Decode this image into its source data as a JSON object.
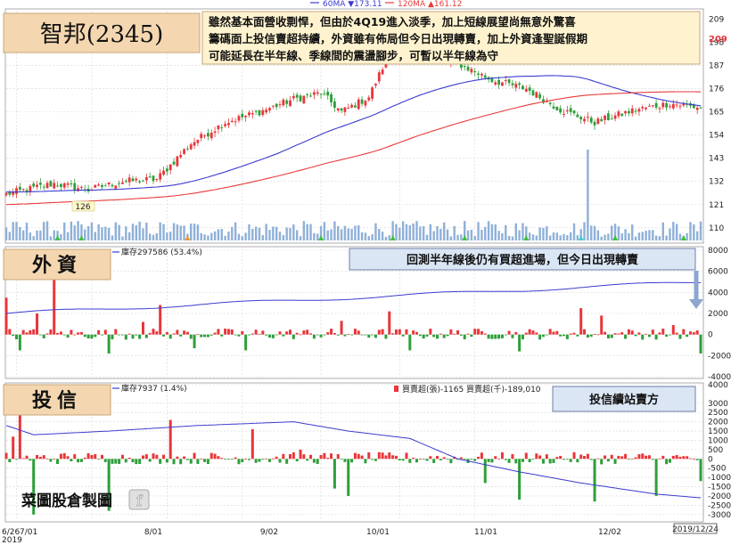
{
  "title": {
    "stock": "智邦(2345)"
  },
  "legend": {
    "ma60": "60MA ▼173.11",
    "ma120": "120MA ▲161.12",
    "ma60_color": "#3b3bd0",
    "ma120_color": "#e83a3a"
  },
  "note": {
    "lines": [
      "雖然基本面營收剽悍，但由於4Q19進入淡季，加上短線展望尚無意外驚喜",
      "籌碼面上投信賣超持續，外資雖有佈局但今日出現轉賣，加上外資逢聖誕假期",
      "可能延長在半年線、季線間的震盪腳步，可暫以半年線為守"
    ]
  },
  "panels": {
    "foreign": {
      "label": "外資",
      "inventory_label": "庫存297586 (53.4%)",
      "annotation": "回測半年線後仍有買超進場，但今日出現轉賣"
    },
    "trust": {
      "label": "投信",
      "inventory_label": "庫存7937 (1.4%)",
      "summary_label": "買賣超(張)-1165 買賣超(千)-189,010",
      "annotation": "投信續站賣方"
    }
  },
  "watermark": "菜圖股倉製圖",
  "date_box": "2019/12/24",
  "colors": {
    "up": "#e8363a",
    "down": "#2e9e3a",
    "volume": "#8fb0d8",
    "note_bg": "#fff3cf",
    "label_bg": "#f4d7b0",
    "annotation_bg": "#dbe6f5",
    "grid": "#d6d6d6"
  },
  "chart_data": [
    {
      "type": "candlestick",
      "name": "price",
      "yticks": [
        110,
        121,
        132,
        143,
        154,
        165,
        176,
        187,
        198,
        209
      ],
      "y_range": [
        104,
        213
      ],
      "last_price_label": "209",
      "start_price": 126,
      "ma_start": {
        "ma60": 127,
        "ma120": 121
      },
      "min_label": "126",
      "x_ticks": [
        "6/26",
        "7/01",
        "8/01",
        "9/02",
        "10/01",
        "11/01",
        "12/02"
      ],
      "x_tick_year": "2019",
      "waypoints": [
        [
          0,
          126
        ],
        [
          14,
          131
        ],
        [
          24,
          128
        ],
        [
          34,
          132
        ],
        [
          44,
          133
        ],
        [
          54,
          150
        ],
        [
          64,
          160
        ],
        [
          74,
          165
        ],
        [
          84,
          171
        ],
        [
          92,
          174
        ],
        [
          98,
          165
        ],
        [
          106,
          172
        ],
        [
          112,
          193
        ],
        [
          122,
          192
        ],
        [
          132,
          188
        ],
        [
          142,
          180
        ],
        [
          152,
          176
        ],
        [
          162,
          166
        ],
        [
          172,
          160
        ],
        [
          184,
          166
        ],
        [
          194,
          169
        ],
        [
          203,
          167
        ]
      ],
      "volume_spike_index": 170
    },
    {
      "type": "bar",
      "name": "foreign",
      "yticks": [
        -4000,
        -2000,
        0,
        2000,
        4000,
        6000,
        8000
      ],
      "y_range": [
        -4000,
        8000
      ],
      "highlights": [
        [
          0,
          3500
        ],
        [
          4,
          -1500
        ],
        [
          9,
          2000
        ],
        [
          14,
          5500
        ],
        [
          30,
          -1800
        ],
        [
          40,
          1200
        ],
        [
          45,
          2800
        ],
        [
          55,
          -1300
        ],
        [
          70,
          -1500
        ],
        [
          98,
          1300
        ],
        [
          112,
          2200
        ],
        [
          118,
          -1500
        ],
        [
          150,
          -1600
        ],
        [
          168,
          2500
        ],
        [
          174,
          1800
        ],
        [
          195,
          900
        ],
        [
          203,
          -1800
        ]
      ]
    },
    {
      "type": "bar",
      "name": "trust",
      "yticks": [
        -3000,
        -2500,
        -2000,
        -1500,
        -1000,
        -500,
        0,
        500,
        1000,
        1500,
        2000,
        2500,
        3000,
        4000
      ],
      "y_range": [
        -3300,
        4000
      ],
      "highlights": [
        [
          2,
          1200
        ],
        [
          4,
          2500
        ],
        [
          8,
          -3000
        ],
        [
          30,
          -2800
        ],
        [
          48,
          2100
        ],
        [
          72,
          1600
        ],
        [
          86,
          500
        ],
        [
          96,
          -1600
        ],
        [
          100,
          -2000
        ],
        [
          140,
          -1300
        ],
        [
          150,
          -2200
        ],
        [
          172,
          -2300
        ],
        [
          190,
          -2000
        ],
        [
          203,
          -1200
        ]
      ]
    }
  ]
}
